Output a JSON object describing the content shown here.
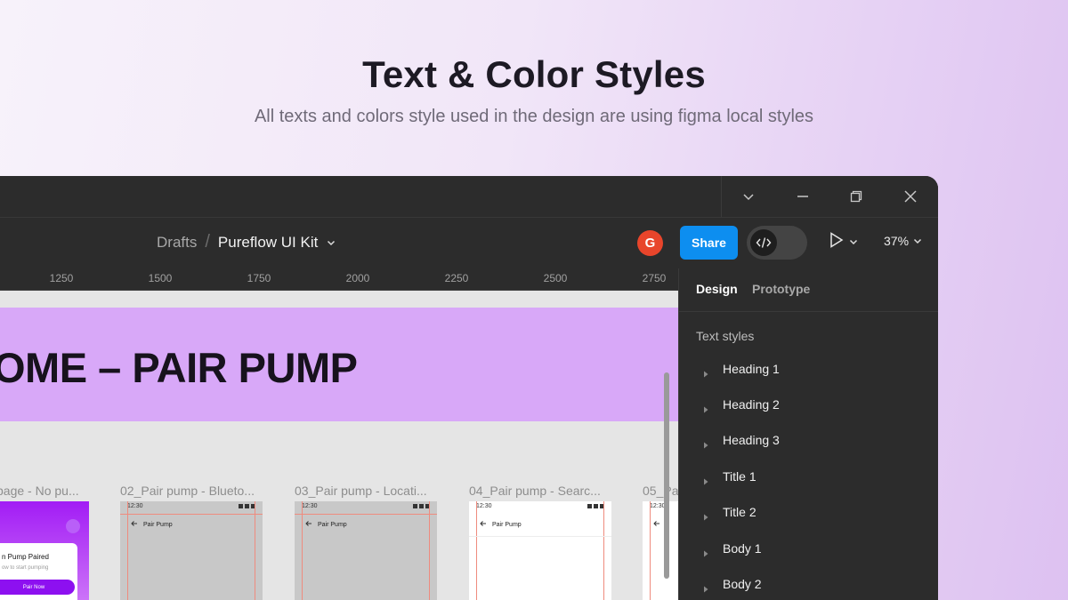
{
  "hero": {
    "title": "Text & Color Styles",
    "subtitle": "All texts and colors style used in the design are using figma local styles"
  },
  "toolbar": {
    "breadcrumb_root": "Drafts",
    "breadcrumb_sep": "/",
    "file_name": "Pureflow UI Kit",
    "avatar_initial": "G",
    "share_label": "Share",
    "zoom": "37%"
  },
  "ruler": {
    "labels": [
      "1250",
      "1500",
      "1750",
      "2000",
      "2250",
      "2500",
      "2750"
    ]
  },
  "canvas": {
    "banner_text": "OME – PAIR PUMP",
    "frames": [
      {
        "label": "page - No pu..."
      },
      {
        "label": "02_Pair pump - Blueto..."
      },
      {
        "label": "03_Pair pump - Locati..."
      },
      {
        "label": "04_Pair pump - Searc..."
      },
      {
        "label": "05_Pa"
      }
    ],
    "frame_time": "12:30",
    "frame_nav_title": "Pair Pump",
    "frame1_card_title": "n Pump Paired",
    "frame1_card_sub": "ow to start pumping",
    "frame1_card_button": "Pair Now"
  },
  "panel": {
    "tabs": [
      "Design",
      "Prototype"
    ],
    "section_title": "Text styles",
    "styles": [
      "Heading 1",
      "Heading 2",
      "Heading 3",
      "Title 1",
      "Title 2",
      "Body 1",
      "Body 2"
    ]
  },
  "colors": {
    "accent": "#0d8ef0",
    "avatar": "#e8452b",
    "banner": "#d8a8f8",
    "panel_bg": "#2c2c2c"
  },
  "icons": {
    "window": [
      "chevron-down-icon",
      "minimize-icon",
      "restore-icon",
      "close-icon"
    ],
    "toolbar": [
      "code-icon",
      "play-icon",
      "chevron-down-icon"
    ],
    "panel": [
      "caret-right-icon"
    ]
  }
}
